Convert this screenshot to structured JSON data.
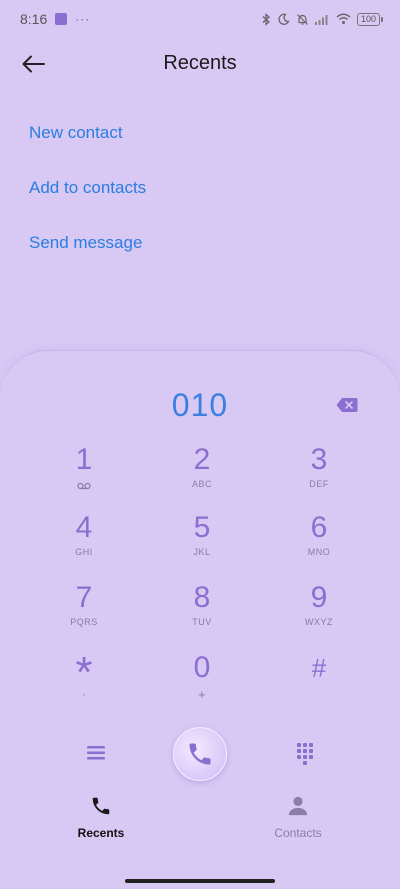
{
  "status_bar": {
    "time": "8:16",
    "more": "···",
    "battery": "100"
  },
  "header": {
    "title": "Recents"
  },
  "actions": [
    {
      "label": "New contact"
    },
    {
      "label": "Add to contacts"
    },
    {
      "label": "Send message"
    }
  ],
  "dialpad": {
    "number": "010",
    "keys": [
      {
        "digit": "1",
        "letters": ""
      },
      {
        "digit": "2",
        "letters": "ABC"
      },
      {
        "digit": "3",
        "letters": "DEF"
      },
      {
        "digit": "4",
        "letters": "GHI"
      },
      {
        "digit": "5",
        "letters": "JKL"
      },
      {
        "digit": "6",
        "letters": "MNO"
      },
      {
        "digit": "7",
        "letters": "PQRS"
      },
      {
        "digit": "8",
        "letters": "TUV"
      },
      {
        "digit": "9",
        "letters": "WXYZ"
      },
      {
        "digit": "*",
        "letters": ","
      },
      {
        "digit": "0",
        "letters": "+"
      },
      {
        "digit": "#",
        "letters": ""
      }
    ]
  },
  "nav": {
    "recents": "Recents",
    "contacts": "Contacts"
  },
  "colors": {
    "accent": "#2b7de0",
    "key": "#8a6fcf",
    "background": "#d8c8f4"
  }
}
